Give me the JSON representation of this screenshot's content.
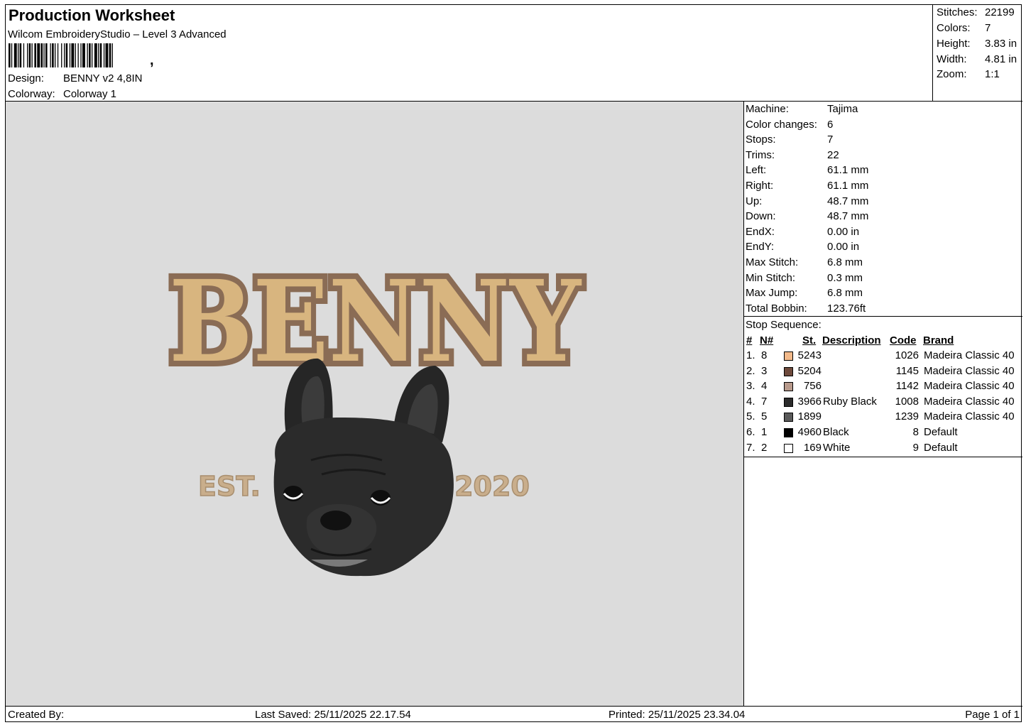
{
  "header": {
    "title": "Production Worksheet",
    "software": "Wilcom EmbroideryStudio – Level 3 Advanced",
    "design_label": "Design:",
    "design_value": "BENNY v2 4,8IN",
    "colorway_label": "Colorway:",
    "colorway_value": "Colorway 1"
  },
  "summary": [
    {
      "label": "Stitches:",
      "value": "22199"
    },
    {
      "label": "Colors:",
      "value": "7"
    },
    {
      "label": "Height:",
      "value": "3.83 in"
    },
    {
      "label": "Width:",
      "value": "4.81 in"
    },
    {
      "label": "Zoom:",
      "value": "1:1"
    }
  ],
  "artwork": {
    "name_text": "BENNY",
    "est_text": "EST.",
    "year_text": "2020",
    "colors": {
      "fill": "#d8b57f",
      "outline": "#8a6c55",
      "dog": "#2a2a2a",
      "small_text": "#c9ae8c"
    }
  },
  "details": [
    {
      "label": "Machine:",
      "value": "Tajima"
    },
    {
      "label": "Color changes:",
      "value": "6"
    },
    {
      "label": "Stops:",
      "value": "7"
    },
    {
      "label": "Trims:",
      "value": "22"
    },
    {
      "label": "Left:",
      "value": "61.1 mm"
    },
    {
      "label": "Right:",
      "value": "61.1 mm"
    },
    {
      "label": "Up:",
      "value": "48.7 mm"
    },
    {
      "label": "Down:",
      "value": "48.7 mm"
    },
    {
      "label": "EndX:",
      "value": "0.00 in"
    },
    {
      "label": "EndY:",
      "value": "0.00 in"
    },
    {
      "label": "Max Stitch:",
      "value": "6.8 mm"
    },
    {
      "label": "Min Stitch:",
      "value": "0.3 mm"
    },
    {
      "label": "Max Jump:",
      "value": "6.8 mm"
    },
    {
      "label": "Total Bobbin:",
      "value": "123.76ft"
    }
  ],
  "stop_sequence": {
    "title": "Stop Sequence:",
    "headers": {
      "num": "#",
      "n": "N#",
      "st": "St.",
      "desc": "Description",
      "code": "Code",
      "brand": "Brand"
    },
    "rows": [
      {
        "num": "1.",
        "n": "8",
        "color": "#f2b98a",
        "st": "5243",
        "desc": "",
        "code": "1026",
        "brand": "Madeira Classic 40"
      },
      {
        "num": "2.",
        "n": "3",
        "color": "#6e4a3c",
        "st": "5204",
        "desc": "",
        "code": "1145",
        "brand": "Madeira Classic 40"
      },
      {
        "num": "3.",
        "n": "4",
        "color": "#b89a8c",
        "st": "756",
        "desc": "",
        "code": "1142",
        "brand": "Madeira Classic 40"
      },
      {
        "num": "4.",
        "n": "7",
        "color": "#2c2c2c",
        "st": "3966",
        "desc": "Ruby Black",
        "code": "1008",
        "brand": "Madeira Classic 40"
      },
      {
        "num": "5.",
        "n": "5",
        "color": "#5a5a5a",
        "st": "1899",
        "desc": "",
        "code": "1239",
        "brand": "Madeira Classic 40"
      },
      {
        "num": "6.",
        "n": "1",
        "color": "#000000",
        "st": "4960",
        "desc": "Black",
        "code": "8",
        "brand": "Default"
      },
      {
        "num": "7.",
        "n": "2",
        "color": "#ffffff",
        "st": "169",
        "desc": "White",
        "code": "9",
        "brand": "Default"
      }
    ]
  },
  "footer": {
    "created_by": "Created By:",
    "last_saved": "Last Saved: 25/11/2025 22.17.54",
    "printed": "Printed: 25/11/2025 23.34.04",
    "page": "Page 1 of 1"
  }
}
